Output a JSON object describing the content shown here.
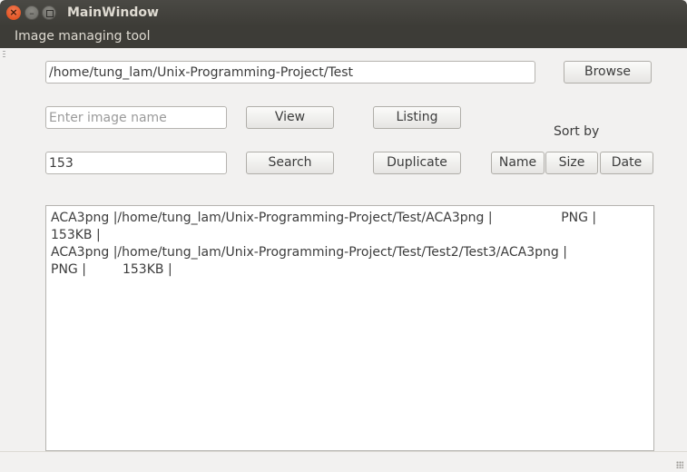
{
  "window": {
    "title": "MainWindow"
  },
  "menubar": {
    "items": [
      {
        "label": "Image managing tool"
      }
    ]
  },
  "path": {
    "value": "/home/tung_lam/Unix-Programming-Project/Test",
    "browse_label": "Browse"
  },
  "view_row": {
    "image_name_placeholder": "Enter image name",
    "image_name_value": "",
    "view_label": "View",
    "listing_label": "Listing"
  },
  "search_row": {
    "size_value": "153",
    "search_label": "Search",
    "duplicate_label": "Duplicate"
  },
  "sort": {
    "label": "Sort by",
    "name_label": "Name",
    "size_label": "Size",
    "date_label": "Date"
  },
  "results": {
    "lines": [
      "ACA3png |/home/tung_lam/Unix-Programming-Project/Test/ACA3png |                 PNG |",
      "153KB |",
      "ACA3png |/home/tung_lam/Unix-Programming-Project/Test/Test2/Test3/ACA3png |",
      "PNG |         153KB |"
    ]
  },
  "icons": {
    "close": "close-icon",
    "minimize": "minimize-icon",
    "maximize": "maximize-icon"
  }
}
